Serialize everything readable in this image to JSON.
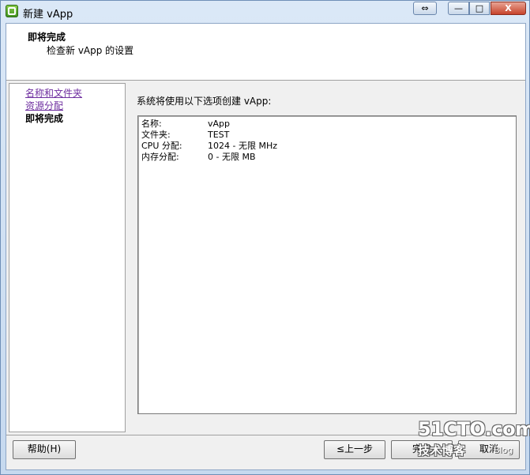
{
  "window": {
    "title": "新建 vApp",
    "controls": {
      "resize": "⇔",
      "minimize": "—",
      "maximize": "□",
      "close": "X"
    }
  },
  "header": {
    "title": "即将完成",
    "subtitle": "检查新 vApp 的设置"
  },
  "sidebar": {
    "items": [
      {
        "label": "名称和文件夹",
        "state": "visited"
      },
      {
        "label": "资源分配",
        "state": "visited"
      },
      {
        "label": "即将完成",
        "state": "current"
      }
    ]
  },
  "main": {
    "intro": "系统将使用以下选项创建 vApp:",
    "summary": [
      {
        "key": "名称:",
        "value": "vApp"
      },
      {
        "key": "文件夹:",
        "value": "TEST"
      },
      {
        "key": "CPU 分配:",
        "value": "1024 - 无限 MHz"
      },
      {
        "key": "内存分配:",
        "value": "0 - 无限 MB"
      }
    ]
  },
  "footer": {
    "help": "帮助(H)",
    "back": "≤上一步",
    "finish": "完成",
    "cancel": "取消"
  },
  "watermark": {
    "site": "51CTO.com",
    "tagline": "技术博客",
    "blog": "Blog"
  }
}
